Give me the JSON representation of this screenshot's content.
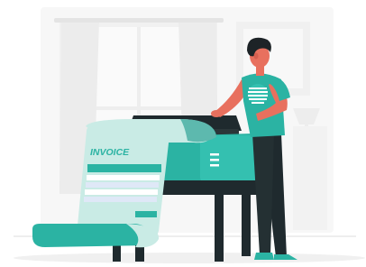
{
  "invoice": {
    "title": "INVOICE"
  },
  "colors": {
    "teal": "#2bb3a3",
    "teal_dark": "#1f8f82",
    "mint_paper": "#c9ebe5",
    "line_blue": "#dfe8f7",
    "dark": "#1f2a2e",
    "skin": "#e8705e",
    "hair": "#1d2327",
    "background_grey": "#f3f3f3"
  },
  "icons": {
    "printer": "printer-icon",
    "person": "person-icon",
    "invoice_paper": "invoice-paper-icon"
  }
}
